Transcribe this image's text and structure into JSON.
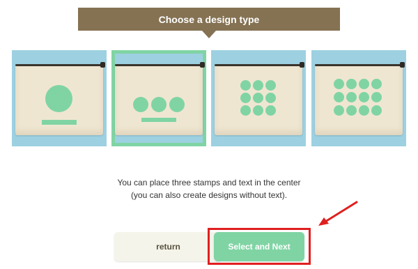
{
  "header": {
    "title": "Choose a design type"
  },
  "options": [
    {
      "name": "one-stamp-design"
    },
    {
      "name": "three-stamp-design",
      "selected": true
    },
    {
      "name": "nine-stamp-design"
    },
    {
      "name": "twelve-stamp-design"
    }
  ],
  "description": {
    "line1": "You can place three stamps and text in the center",
    "line2": "(you can also create designs without text)."
  },
  "buttons": {
    "return_label": "return",
    "next_label": "Select and Next"
  },
  "colors": {
    "header": "#847253",
    "mint": "#80d4a4",
    "tile_bg": "#9dd1e1",
    "annotation": "#e01f1f"
  }
}
